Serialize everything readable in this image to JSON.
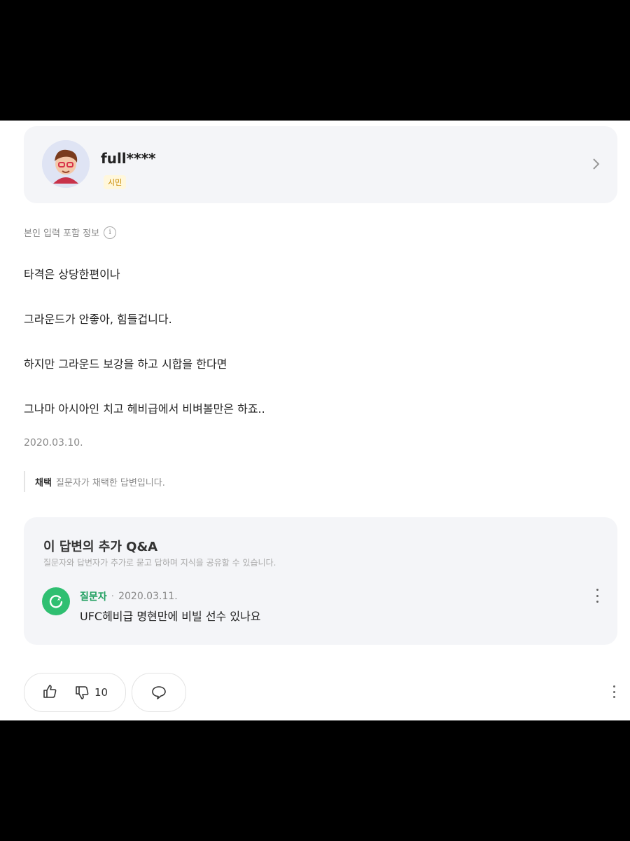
{
  "author": {
    "username": "full****",
    "grade_badge": "시민"
  },
  "info_label": "본인 입력 포함 정보",
  "answer": {
    "lines": [
      "타격은 상당한편이나",
      "그라운드가 안좋아, 힘들겁니다.",
      "하지만 그라운드 보강을 하고 시합을 한다면",
      "그나마 아시아인 치고 헤비급에서 비벼볼만은 하죠.."
    ],
    "date": "2020.03.10."
  },
  "adoption": {
    "tag": "채택",
    "text": "질문자가 채택한 답변입니다."
  },
  "extra_qa": {
    "title": "이 답변의 추가 Q&A",
    "subtitle": "질문자와 답변자가 추가로 묻고 답하며 지식을 공유할 수 있습니다.",
    "item": {
      "author": "질문자",
      "separator": "·",
      "date": "2020.03.11.",
      "text": "UFC헤비급 명현만에 비빌 선수 있나요"
    }
  },
  "actions": {
    "dislike_count": "10"
  },
  "colors": {
    "accent_green": "#2fbf71",
    "card_bg": "#f4f5f8",
    "badge_text": "#c98a00"
  }
}
